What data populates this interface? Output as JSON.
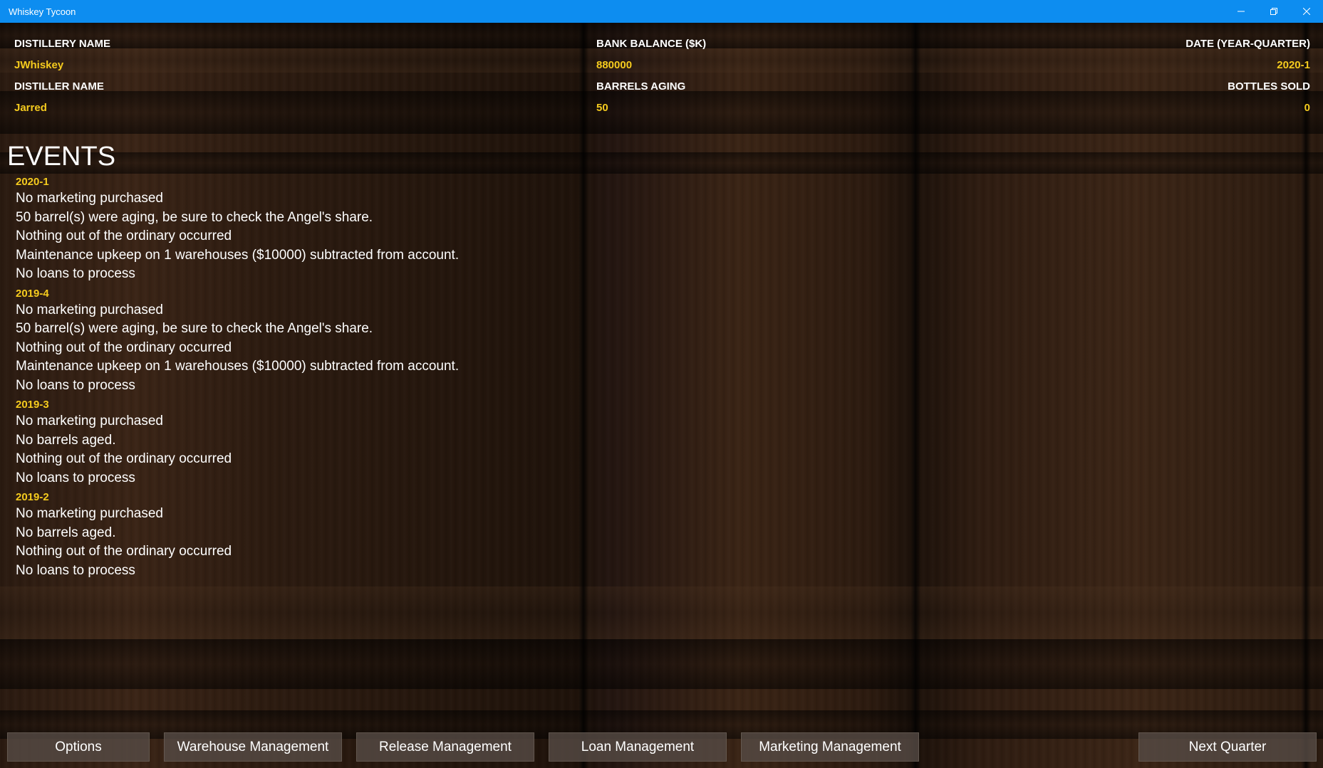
{
  "window": {
    "title": "Whiskey Tycoon"
  },
  "colors": {
    "titlebar": "#0d8df0",
    "value_text": "#f5cb1e",
    "label_text": "#ffffff"
  },
  "stats": {
    "distillery_name_label": "DISTILLERY NAME",
    "distillery_name": "JWhiskey",
    "distiller_name_label": "DISTILLER NAME",
    "distiller_name": "Jarred",
    "bank_balance_label": "BANK BALANCE ($K)",
    "bank_balance": "880000",
    "barrels_aging_label": "BARRELS AGING",
    "barrels_aging": "50",
    "date_label": "DATE (YEAR-QUARTER)",
    "date": "2020-1",
    "bottles_sold_label": "BOTTLES SOLD",
    "bottles_sold": "0"
  },
  "events": {
    "title": "EVENTS",
    "groups": [
      {
        "date": "2020-1",
        "lines": [
          "No marketing purchased",
          "50 barrel(s) were aging, be sure to check the Angel's share.",
          "Nothing out of the ordinary occurred",
          "Maintenance upkeep on 1 warehouses ($10000) subtracted from account.",
          "No loans to process"
        ]
      },
      {
        "date": "2019-4",
        "lines": [
          "No marketing purchased",
          "50 barrel(s) were aging, be sure to check the Angel's share.",
          "Nothing out of the ordinary occurred",
          "Maintenance upkeep on 1 warehouses ($10000) subtracted from account.",
          "No loans to process"
        ]
      },
      {
        "date": "2019-3",
        "lines": [
          "No marketing purchased",
          "No barrels aged.",
          "Nothing out of the ordinary occurred",
          "No loans to process"
        ]
      },
      {
        "date": "2019-2",
        "lines": [
          "No marketing purchased",
          "No barrels aged.",
          "Nothing out of the ordinary occurred",
          "No loans to process"
        ]
      }
    ]
  },
  "buttons": {
    "options": "Options",
    "warehouse": "Warehouse Management",
    "release": "Release Management",
    "loan": "Loan Management",
    "marketing": "Marketing Management",
    "next_quarter": "Next Quarter"
  }
}
